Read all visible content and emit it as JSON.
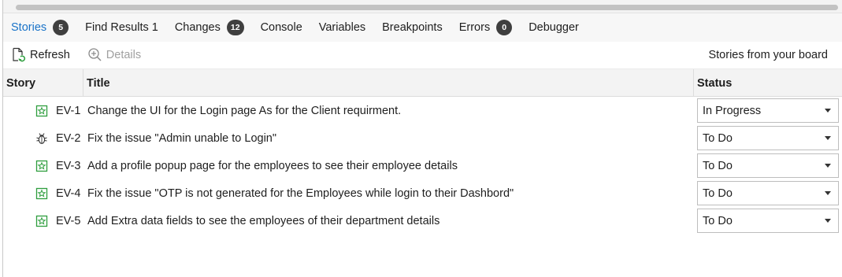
{
  "tabs": [
    {
      "label": "Stories",
      "badge": "5",
      "active": true
    },
    {
      "label": "Find Results 1"
    },
    {
      "label": "Changes",
      "badge": "12"
    },
    {
      "label": "Console"
    },
    {
      "label": "Variables"
    },
    {
      "label": "Breakpoints"
    },
    {
      "label": "Errors",
      "badge": "0"
    },
    {
      "label": "Debugger"
    }
  ],
  "toolbar": {
    "refresh_label": "Refresh",
    "details_label": "Details",
    "info_text": "Stories from your board"
  },
  "table": {
    "headers": {
      "story": "Story",
      "title": "Title",
      "status": "Status"
    },
    "rows": [
      {
        "icon": "story-icon",
        "id": "EV-1",
        "title": "Change the UI for the Login page As for the Client requirment.",
        "status": "In Progress"
      },
      {
        "icon": "bug-icon",
        "id": "EV-2",
        "title": "Fix the issue \"Admin unable to Login\"",
        "status": "To Do"
      },
      {
        "icon": "story-icon",
        "id": "EV-3",
        "title": "Add a profile popup page for the employees to see their employee details",
        "status": "To Do"
      },
      {
        "icon": "story-icon",
        "id": "EV-4",
        "title": "Fix the issue \"OTP is not generated for the Employees while login to their Dashbord\"",
        "status": "To Do"
      },
      {
        "icon": "story-icon",
        "id": "EV-5",
        "title": "Add Extra data fields to see the employees of their department details",
        "status": "To Do"
      }
    ]
  },
  "colors": {
    "active_tab": "#1a73c8",
    "story_icon": "#2e9e3e",
    "badge_bg": "#3f3f3f"
  }
}
